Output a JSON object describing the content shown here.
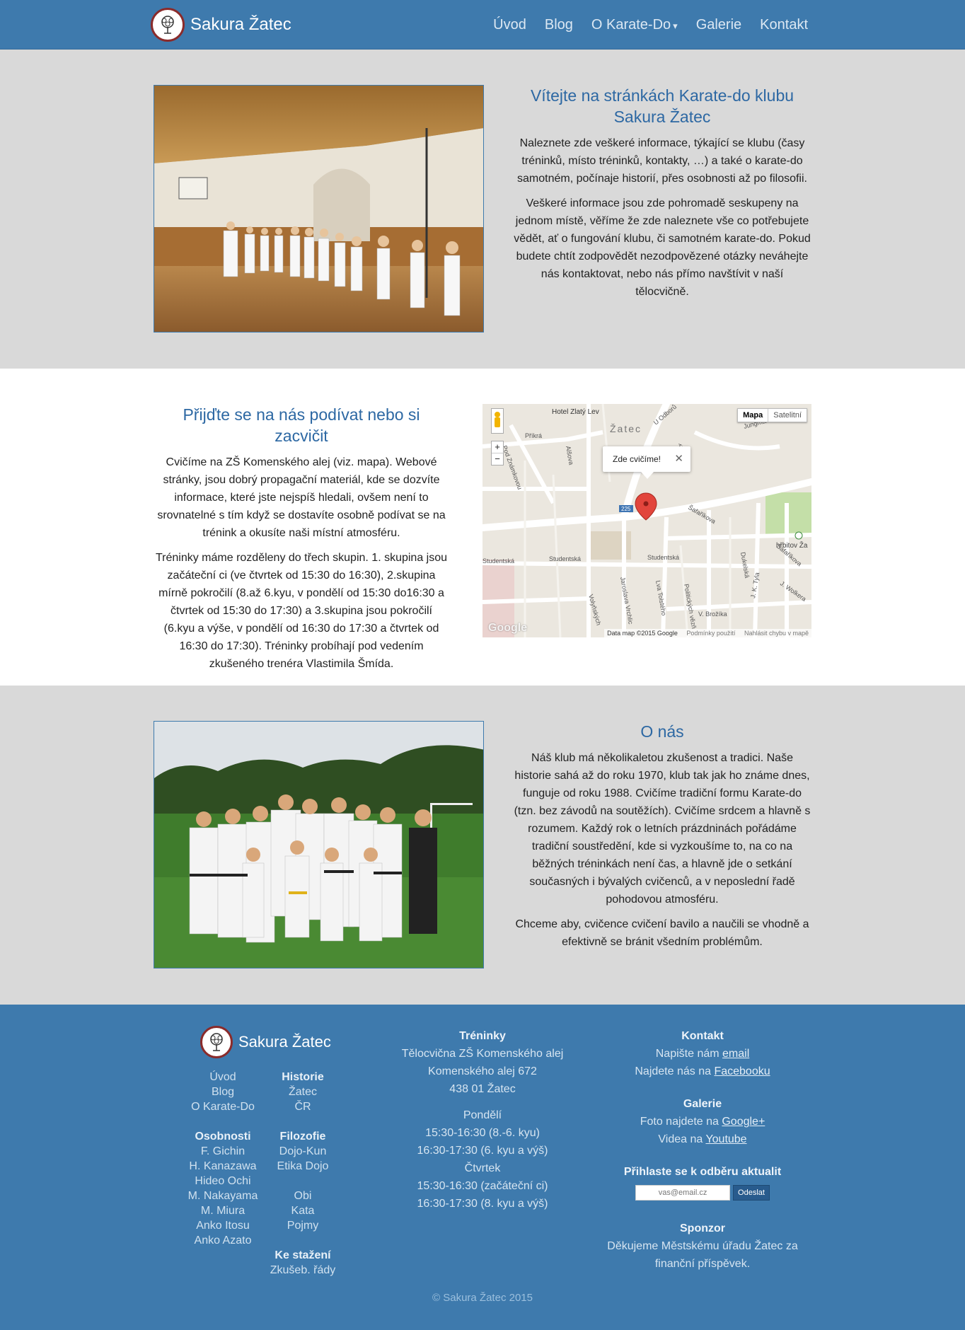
{
  "header": {
    "brand": "Sakura Žatec",
    "nav": [
      "Úvod",
      "Blog",
      "O Karate-Do",
      "Galerie",
      "Kontakt"
    ],
    "dropdown_caret": "▾"
  },
  "welcome": {
    "title": "Vítejte na stránkách Karate-do klubu Sakura Žatec",
    "p1": "Naleznete zde veškeré informace, týkající se klubu (časy tréninků, místo tréninků, kontakty, …) a také o karate-do samotném, počínaje historií, přes osobnosti až po filosofii.",
    "p2": "Veškeré informace jsou zde pohromadě seskupeny na jednom místě, věříme že zde naleznete vše co potřebujete vědět, ať o fungování klubu, či samotném karate-do. Pokud budete chtít zodpovědět nezodpovězené otázky neváhejte nás kontaktovat, nebo nás přímo navštívit v naší tělocvičně."
  },
  "visit": {
    "title": "Přijďte se na nás podívat nebo si zacvičit",
    "p1": "Cvičíme na ZŠ Komenského alej (viz. mapa). Webové stránky, jsou dobrý propagační materiál, kde se dozvíte informace, které jste nejspíš hledali, ovšem není to srovnatelné s tím když se dostavíte osobně podívat se na trénink a okusíte naši místní atmosféru.",
    "p2": "Tréninky máme rozděleny do třech skupin. 1. skupina jsou začáteční ci (ve čtvrtek od 15:30 do 16:30), 2.skupina mírně pokročilí (8.až 6.kyu, v pondělí od 15:30 do16:30 a čtvrtek od 15:30 do 17:30) a 3.skupina jsou pokročilí (6.kyu a výše, v pondělí od 16:30 do 17:30 a čtvrtek od 16:30 do 17:30). Tréninky probíhají pod vedením zkušeného trenéra Vlastimila Šmída."
  },
  "map": {
    "type_map": "Mapa",
    "type_sat": "Satelitní",
    "infowindow": "Zde cvičíme!",
    "close": "✕",
    "zoom_in": "+",
    "zoom_out": "−",
    "attribution": "Data map ©2015 Google",
    "terms": "Podmínky použití",
    "report": "Nahlásit chybu v mapě",
    "google": "Google",
    "labels": {
      "hotel": "Hotel Zlatý Lev",
      "zatec": "Žatec",
      "odboru": "U Odborů",
      "prikra": "Příkrá",
      "znamkovou": "Pod Známkovou",
      "alsova": "Alšova",
      "trnk": "Trnk",
      "safarikova": "Šafaříkova",
      "studentska1": "Studentská",
      "studentska2": "Studentská",
      "studentska3": "Studentská",
      "volynskych": "Volyňských",
      "jaroslava": "Jaroslava Vrchlic",
      "tolsteho": "Lva Tolstého",
      "politickych": "Politických vězň",
      "dukelska": "Dukelská",
      "brozika": "V. Brožíka",
      "tyla": "J. K. Tyla",
      "wolkera": "J. Wolkera",
      "hrbitov": "hřbitov Ža",
      "safarikova2": "Šafaříkova",
      "jungmannova": "Jungmannova",
      "road225": "225"
    }
  },
  "about": {
    "title": "O nás",
    "p1": "Náš klub má několikaletou zkušenost a tradici. Naše historie sahá až do roku 1970, klub tak jak ho známe dnes, funguje od roku 1988. Cvičíme tradiční formu Karate-do (tzn. bez závodů na soutěžích). Cvičíme srdcem a hlavně s rozumem. Každý rok o letních prázdninách pořádáme tradiční soustředění, kde si vyzkoušíme to, na co na běžných tréninkách není čas, a hlavně jde o setkání současných i bývalých cvičenců, a v neposlední řadě pohodovou atmosféru.",
    "p2": "Chceme aby, cvičence cvičení bavilo a naučili se vhodně a efektivně se bránit všedním problémům."
  },
  "footer": {
    "brand": "Sakura Žatec",
    "col1": {
      "links1": [
        "Úvod",
        "Blog",
        "O Karate-Do"
      ],
      "osobnosti_h": "Osobnosti",
      "osobnosti": [
        "F. Gichin",
        "H. Kanazawa",
        "Hideo Ochi",
        "M. Nakayama",
        "M. Miura",
        "Anko Itosu",
        "Anko Azato"
      ]
    },
    "col2": {
      "historie_h": "Historie",
      "historie": [
        "Žatec",
        "ČR"
      ],
      "filozofie_h": "Filozofie",
      "filozofie": [
        "Dojo-Kun",
        "Etika Dojo"
      ],
      "other": [
        "Obi",
        "Kata",
        "Pojmy"
      ],
      "stazeni_h": "Ke stažení",
      "stazeni": [
        "Zkušeb. řády"
      ]
    },
    "treninky": {
      "h": "Tréninky",
      "place1": "Tělocvična ZŠ Komenského alej",
      "place2": "Komenského alej 672",
      "place3": "438 01 Žatec",
      "mon": "Pondělí",
      "mon1": "15:30-16:30 (8.-6. kyu)",
      "mon2": "16:30-17:30 (6. kyu a výš)",
      "thu": "Čtvrtek",
      "thu1": "15:30-16:30 (začáteční ci)",
      "thu2": "16:30-17:30 (8. kyu a výš)"
    },
    "kontakt": {
      "h": "Kontakt",
      "email_pre": "Napište nám ",
      "email_link": "email",
      "fb_pre": "Najdete nás na ",
      "fb_link": "Facebooku"
    },
    "galerie": {
      "h": "Galerie",
      "foto_pre": "Foto najdete na ",
      "foto_link": "Google+",
      "video_pre": "Videa na ",
      "video_link": "Youtube"
    },
    "subscribe": {
      "h": "Přihlaste se k odběru aktualit",
      "placeholder": "vas@email.cz",
      "button": "Odeslat"
    },
    "sponzor": {
      "h": "Sponzor",
      "text": "Děkujeme Městskému úřadu Žatec za finanční příspěvek."
    },
    "copyright": "© Sakura Žatec 2015"
  }
}
